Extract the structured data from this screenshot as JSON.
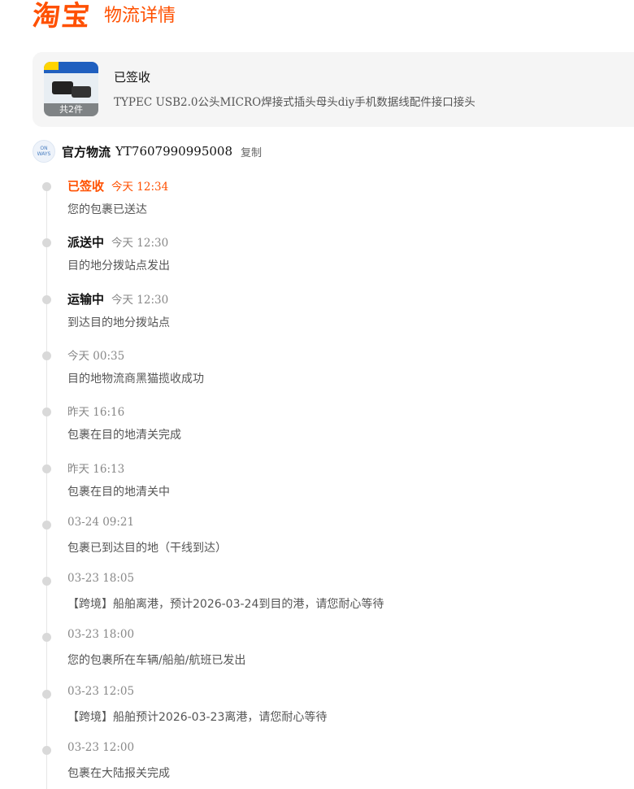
{
  "header": {
    "logo": "淘宝",
    "title": "物流详情"
  },
  "colors": {
    "accent": "#ff5000",
    "timeline_dot": "#d9d9d9",
    "card_bg": "#f5f5f5"
  },
  "product": {
    "status": "已签收",
    "name": "TYPEC USB2.0公头MICRO焊接式插头母头diy手机数据线配件接口接头",
    "count_badge": "共2件",
    "thumb_icon": "usb-plug-product-image"
  },
  "carrier": {
    "logo_text": "ON\nWAYS",
    "name": "官方物流",
    "tracking_no": "YT7607990995008",
    "copy_label": "复制"
  },
  "events": [
    {
      "status": "已签收",
      "time": "今天 12:34",
      "desc": "您的包裹已送达",
      "current": true
    },
    {
      "status": "派送中",
      "time": "今天 12:30",
      "desc": "目的地分拨站点发出",
      "current": false
    },
    {
      "status": "运输中",
      "time": "今天 12:30",
      "desc": "到达目的地分拨站点",
      "current": false
    },
    {
      "status": "",
      "time": "今天 00:35",
      "desc": "目的地物流商黑猫揽收成功",
      "current": false
    },
    {
      "status": "",
      "time": "昨天 16:16",
      "desc": "包裹在目的地清关完成",
      "current": false
    },
    {
      "status": "",
      "time": "昨天 16:13",
      "desc": "包裹在目的地清关中",
      "current": false
    },
    {
      "status": "",
      "time": "03-24 09:21",
      "desc": "包裹已到达目的地（干线到达）",
      "current": false
    },
    {
      "status": "",
      "time": "03-23 18:05",
      "desc": "【跨境】船舶离港，预计2026-03-24到目的港，请您耐心等待",
      "current": false
    },
    {
      "status": "",
      "time": "03-23 18:00",
      "desc": "您的包裹所在车辆/船舶/航班已发出",
      "current": false
    },
    {
      "status": "",
      "time": "03-23 12:05",
      "desc": "【跨境】船舶预计2026-03-23离港，请您耐心等待",
      "current": false
    },
    {
      "status": "",
      "time": "03-23 12:00",
      "desc": "包裹在大陆报关完成",
      "current": false
    }
  ]
}
